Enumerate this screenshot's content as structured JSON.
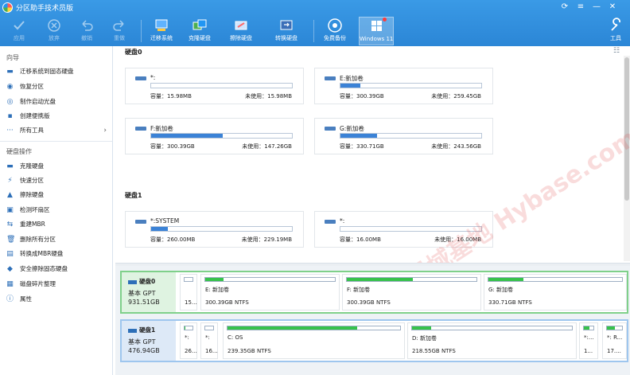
{
  "app": {
    "title": "分区助手技术员版",
    "colors": {
      "titlebar": "#2b86d6",
      "accent": "#3b82d6",
      "partition_used": "#37c24b",
      "selected_border": "#7fd08a"
    }
  },
  "toolbar": {
    "items": [
      {
        "label": "应用",
        "icon": "check-icon",
        "enabled": false
      },
      {
        "label": "放弃",
        "icon": "discard-icon",
        "enabled": false
      },
      {
        "label": "撤销",
        "icon": "undo-icon",
        "enabled": false
      },
      {
        "label": "重做",
        "icon": "redo-icon",
        "enabled": false
      },
      {
        "label": "迁移系统",
        "icon": "migrate-os-icon",
        "enabled": true
      },
      {
        "label": "克隆硬盘",
        "icon": "clone-disk-icon",
        "enabled": true
      },
      {
        "label": "擦除硬盘",
        "icon": "wipe-disk-icon",
        "enabled": true
      },
      {
        "label": "转换硬盘",
        "icon": "convert-disk-icon",
        "enabled": true
      },
      {
        "label": "免费备份",
        "icon": "backup-icon",
        "enabled": true
      },
      {
        "label": "Windows 11",
        "icon": "windows11-icon",
        "enabled": true
      },
      {
        "label": "工具",
        "icon": "tools-icon",
        "enabled": true
      }
    ]
  },
  "sidebar": {
    "wizard_heading": "向导",
    "wizard_items": [
      {
        "label": "迁移系统到固态硬盘",
        "icon": "migrate-icon"
      },
      {
        "label": "恢复分区",
        "icon": "recover-icon"
      },
      {
        "label": "制作启动光盘",
        "icon": "bootable-disc-icon"
      },
      {
        "label": "创建便携版",
        "icon": "portable-icon"
      },
      {
        "label": "所有工具",
        "icon": "more-icon"
      }
    ],
    "disk_ops_heading": "硬盘操作",
    "disk_ops_items": [
      {
        "label": "克隆硬盘",
        "icon": "clone-icon"
      },
      {
        "label": "快速分区",
        "icon": "quick-partition-icon"
      },
      {
        "label": "擦除硬盘",
        "icon": "wipe-icon"
      },
      {
        "label": "检测坏扇区",
        "icon": "bad-sector-icon"
      },
      {
        "label": "重建MBR",
        "icon": "rebuild-mbr-icon"
      },
      {
        "label": "删除所有分区",
        "icon": "delete-all-icon"
      },
      {
        "label": "转换成MBR硬盘",
        "icon": "convert-mbr-icon"
      },
      {
        "label": "安全擦除固态硬盘",
        "icon": "secure-erase-icon"
      },
      {
        "label": "磁盘碎片整理",
        "icon": "defrag-icon"
      },
      {
        "label": "属性",
        "icon": "info-icon"
      }
    ]
  },
  "main": {
    "disks": [
      {
        "heading": "硬盘0",
        "partitions": [
          {
            "name": "*:",
            "capacity_label": "容量：15.98MB",
            "free_label": "未使用：15.98MB",
            "used_fraction": 0.0
          },
          {
            "name": "E:新加卷",
            "capacity_label": "容量：300.39GB",
            "free_label": "未使用：259.45GB",
            "used_fraction": 0.14
          },
          {
            "name": "F:新加卷",
            "capacity_label": "容量：300.39GB",
            "free_label": "未使用：147.26GB",
            "used_fraction": 0.51
          },
          {
            "name": "G:新加卷",
            "capacity_label": "容量：330.71GB",
            "free_label": "未使用：243.56GB",
            "used_fraction": 0.26
          }
        ]
      },
      {
        "heading": "硬盘1",
        "partitions": [
          {
            "name": "*:SYSTEM",
            "capacity_label": "容量：260.00MB",
            "free_label": "未使用：229.19MB",
            "used_fraction": 0.12
          },
          {
            "name": "*:",
            "capacity_label": "容量：16.00MB",
            "free_label": "未使用：16.00MB",
            "used_fraction": 0.0
          }
        ]
      }
    ],
    "watermark": "记得收藏:黑域基地 Hybase.com"
  },
  "disk_map": [
    {
      "name": "硬盘0",
      "type": "基本 GPT",
      "size": "931.51GB",
      "segments": [
        {
          "name": "*:",
          "info": "15...",
          "used_fraction": 0.0
        },
        {
          "name": "E: 新加卷",
          "info": "300.39GB NTFS",
          "used_fraction": 0.14
        },
        {
          "name": "F: 新加卷",
          "info": "300.39GB NTFS",
          "used_fraction": 0.51
        },
        {
          "name": "G: 新加卷",
          "info": "330.71GB NTFS",
          "used_fraction": 0.26
        }
      ]
    },
    {
      "name": "硬盘1",
      "type": "基本 GPT",
      "size": "476.94GB",
      "segments": [
        {
          "name": "*:",
          "info": "26...",
          "used_fraction": 0.12
        },
        {
          "name": "*:",
          "info": "16...",
          "used_fraction": 0.0
        },
        {
          "name": "C: OS",
          "info": "239.35GB NTFS",
          "used_fraction": 0.75
        },
        {
          "name": "D: 新加卷",
          "info": "218.55GB NTFS",
          "used_fraction": 0.12
        },
        {
          "name": "*:...",
          "info": "1...",
          "used_fraction": 0.6
        },
        {
          "name": "*: R...",
          "info": "17....",
          "used_fraction": 0.55
        }
      ]
    }
  ]
}
